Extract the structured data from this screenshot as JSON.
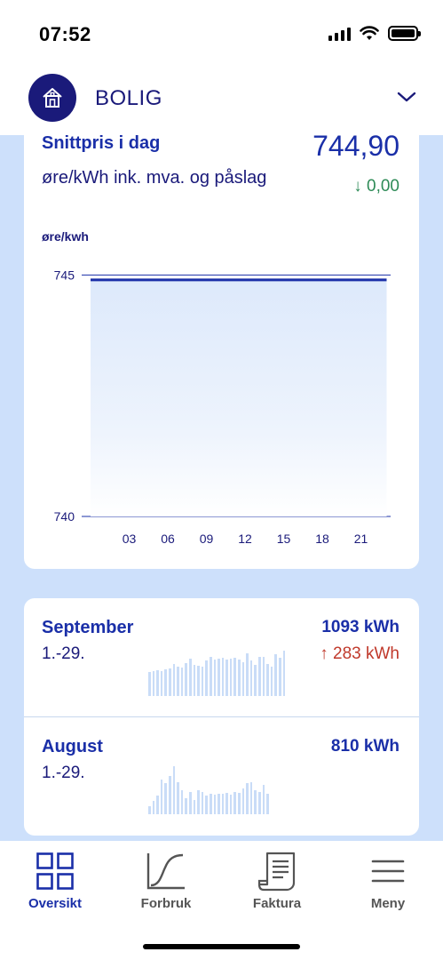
{
  "status_bar": {
    "time": "07:52"
  },
  "header": {
    "title": "BOLIG",
    "icon": "house-icon",
    "chevron": "chevron-down-icon"
  },
  "price_card": {
    "title": "Snittpris i dag",
    "value": "744,90",
    "unit_text": "øre/kWh ink. mva. og påslag",
    "change": "↓ 0,00",
    "axis_unit": "øre/kwh"
  },
  "chart_data": {
    "type": "line",
    "ylabel": "øre/kwh",
    "yticks": [
      "745",
      "740"
    ],
    "ylim": [
      740,
      745.1
    ],
    "xticks": [
      "03",
      "06",
      "09",
      "12",
      "15",
      "18",
      "21"
    ],
    "x_range": [
      0,
      24
    ],
    "series": [
      {
        "x": [
          0,
          23
        ],
        "y": [
          744.9,
          744.9
        ]
      }
    ],
    "grid": true,
    "fill": "area-gradient"
  },
  "consumption": [
    {
      "month": "September",
      "range": "1.-29.",
      "kwh": "1093 kWh",
      "diff": "↑ 283 kWh",
      "bars": [
        0.45,
        0.47,
        0.48,
        0.46,
        0.5,
        0.52,
        0.6,
        0.55,
        0.53,
        0.62,
        0.7,
        0.58,
        0.56,
        0.55,
        0.66,
        0.74,
        0.68,
        0.7,
        0.72,
        0.69,
        0.7,
        0.71,
        0.68,
        0.64,
        0.8,
        0.66,
        0.58,
        0.73,
        0.74,
        0.6,
        0.55,
        0.78,
        0.72,
        0.85
      ]
    },
    {
      "month": "August",
      "range": "1.-29.",
      "kwh": "810 kWh",
      "diff": "",
      "bars": [
        0.15,
        0.25,
        0.35,
        0.65,
        0.58,
        0.72,
        0.9,
        0.6,
        0.45,
        0.3,
        0.42,
        0.26,
        0.45,
        0.42,
        0.35,
        0.38,
        0.36,
        0.38,
        0.38,
        0.4,
        0.36,
        0.42,
        0.4,
        0.48,
        0.58,
        0.6,
        0.45,
        0.42,
        0.55,
        0.38
      ]
    }
  ],
  "nav": [
    {
      "label": "Oversikt",
      "icon": "grid-icon",
      "active": true
    },
    {
      "label": "Forbruk",
      "icon": "curve-chart-icon",
      "active": false
    },
    {
      "label": "Faktura",
      "icon": "receipt-icon",
      "active": false
    },
    {
      "label": "Meny",
      "icon": "hamburger-menu-icon",
      "active": false
    }
  ]
}
